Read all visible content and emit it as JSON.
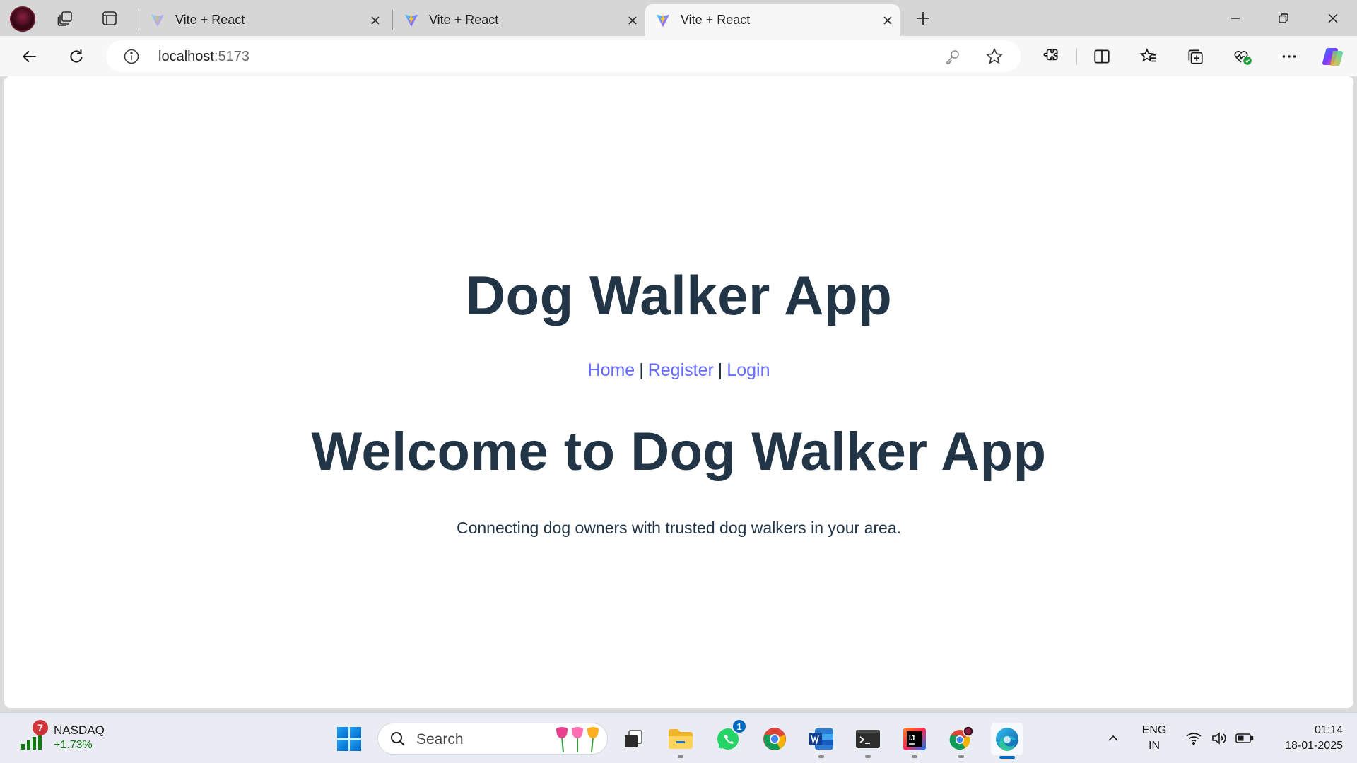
{
  "browser": {
    "tabs": [
      {
        "title": "Vite + React",
        "active": false
      },
      {
        "title": "Vite + React",
        "active": false
      },
      {
        "title": "Vite + React",
        "active": true
      }
    ],
    "address": {
      "host": "localhost",
      "port": ":5173"
    }
  },
  "page": {
    "app_title": "Dog Walker App",
    "nav": [
      {
        "label": "Home"
      },
      {
        "label": "Register"
      },
      {
        "label": "Login"
      }
    ],
    "nav_separator": "|",
    "heading": "Welcome to Dog Walker App",
    "tagline": "Connecting dog owners with trusted dog walkers in your area.",
    "colors": {
      "text": "#213547",
      "link": "#646cff",
      "background": "#ffffff"
    }
  },
  "taskbar": {
    "widget": {
      "name": "NASDAQ",
      "change": "+1.73%",
      "badge": "7"
    },
    "search_label": "Search",
    "whatsapp_badge": "1",
    "lang_top": "ENG",
    "lang_bottom": "IN",
    "time": "01:14",
    "date": "18-01-2025"
  }
}
